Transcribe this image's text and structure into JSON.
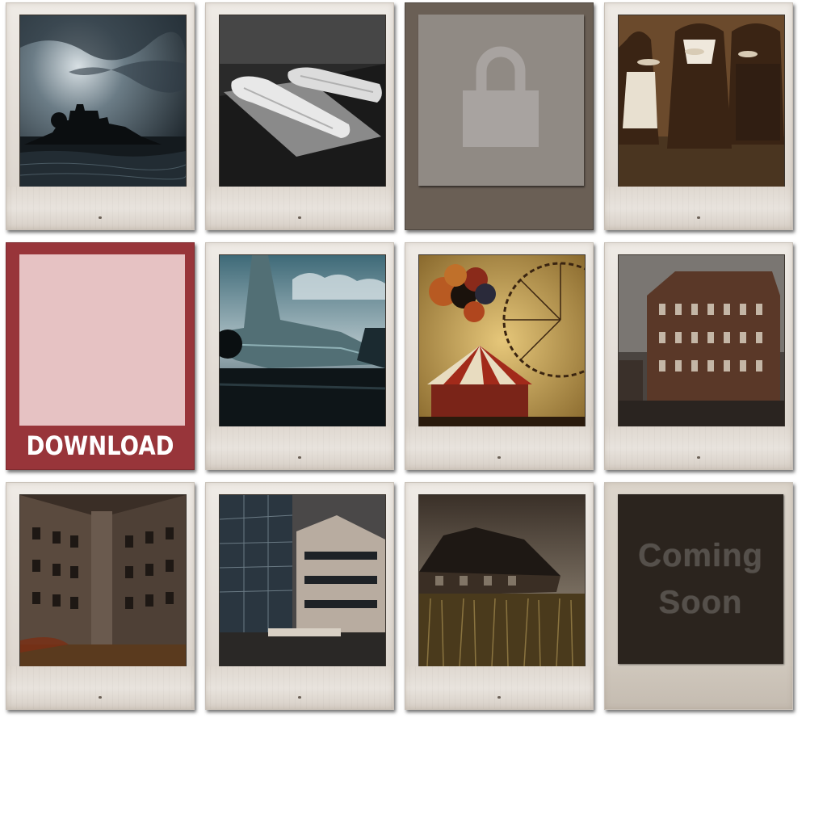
{
  "cards": [
    {
      "id": "card-1",
      "kind": "photo",
      "scene": "castle-on-island"
    },
    {
      "id": "card-2",
      "kind": "photo",
      "scene": "shrouded-bodies"
    },
    {
      "id": "card-3",
      "kind": "locked",
      "icon": "lock-icon"
    },
    {
      "id": "card-4",
      "kind": "photo",
      "scene": "three-women"
    },
    {
      "id": "card-5",
      "kind": "download",
      "label": "DOWNLOAD"
    },
    {
      "id": "card-6",
      "kind": "photo",
      "scene": "abandoned-jet"
    },
    {
      "id": "card-7",
      "kind": "photo",
      "scene": "carnival-balloons"
    },
    {
      "id": "card-8",
      "kind": "photo",
      "scene": "brick-building"
    },
    {
      "id": "card-9",
      "kind": "photo",
      "scene": "ruined-courtyard"
    },
    {
      "id": "card-10",
      "kind": "photo",
      "scene": "office-tower"
    },
    {
      "id": "card-11",
      "kind": "photo",
      "scene": "barn-in-cornfield"
    },
    {
      "id": "card-12",
      "kind": "coming-soon",
      "label": "Coming\nSoon"
    }
  ],
  "colors": {
    "frame": "#e6e1db",
    "download_frame": "#98353a",
    "download_panel": "#e6c2c3",
    "locked_frame": "#6a5f55",
    "locked_panel": "#908a84",
    "soon_panel": "#2b241e"
  }
}
